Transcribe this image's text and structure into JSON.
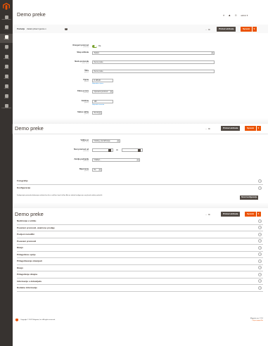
{
  "sidebar": {
    "items": [
      {
        "label": "Nadzorna ploča",
        "icon": "dashboard-icon"
      },
      {
        "label": "Prodaja",
        "icon": "dollar-icon"
      },
      {
        "label": "Katalog",
        "icon": "box-icon"
      },
      {
        "label": "Kupci",
        "icon": "user-icon"
      },
      {
        "label": "Marketing",
        "icon": "megaphone-icon"
      },
      {
        "label": "Sadržaj",
        "icon": "layout-icon"
      },
      {
        "label": "Izvještaji",
        "icon": "bar-chart-icon"
      },
      {
        "label": "Trgovine",
        "icon": "store-icon"
      },
      {
        "label": "Sustav",
        "icon": "gear-icon"
      },
      {
        "label": "Pronađi partnere",
        "icon": "partners-icon"
      }
    ],
    "active_index": 2
  },
  "header": {
    "title": "Demo preke",
    "user": "admin ▾"
  },
  "actions": {
    "back": "← Iši",
    "add_attribute": "Pridod atributa",
    "save": "Spremi"
  },
  "store_switch": {
    "label": "Područje",
    "value": "Zadani prikaz trgovine ▾",
    "help": "?"
  },
  "form1": {
    "rows": [
      {
        "label": "Omogući proizvod",
        "scope": "[website]",
        "value": "Da"
      },
      {
        "label": "Skup atributa",
        "value": "Zadani"
      },
      {
        "label": "Naziv proizvoda",
        "scope": "[store view]",
        "value": "Demo preke"
      },
      {
        "label": "Šifra",
        "scope": "[global]",
        "value": "Demo preke"
      },
      {
        "label": "Cijena",
        "scope": "[global]",
        "value": "€ 135,00",
        "link": "Napredne cijene"
      },
      {
        "label": "Klasa poreza",
        "scope": "[website]",
        "value": "Oporezivi proizvod"
      },
      {
        "label": "Količina",
        "scope": "[global]",
        "value": "100",
        "link": "Napredni inventar"
      },
      {
        "label": "Status zaliha",
        "scope": "[global]",
        "value": "Na zalihi"
      }
    ]
  },
  "form2": {
    "rows": [
      {
        "label": "Vidljivost",
        "scope": "[store view]",
        "value": "Katalog, pretraživanje"
      },
      {
        "label": "Novi proizvod od",
        "scope": "[website]",
        "value": "",
        "to": "do"
      },
      {
        "label": "Zemlja podrijetla",
        "scope": "[website]",
        "value": "Odaberi..."
      },
      {
        "label": "Napomena",
        "scope": "[global]",
        "value": "Ne"
      }
    ]
  },
  "sections1": [
    {
      "title": "Fotografije"
    },
    {
      "title": "Konfiguracije"
    }
  ],
  "config_note": "Konfigurirajte proizvode dodavanjem atributa kao što su veličina, boja ili slično. Ako ne trebate konfiguracije, ovaj korak možete preskočiti.",
  "config_button": "Stvori konfiguracije",
  "sections2": [
    {
      "title": "Nadziranje u vidiku"
    },
    {
      "title": "Poveženi proizvodi, unakrsne prodaje"
    },
    {
      "title": "Povijest narudžbi"
    },
    {
      "title": "Povezani proizvodi"
    },
    {
      "title": "Dizajn"
    },
    {
      "title": "Prilagođene opcije"
    },
    {
      "title": "Prilagođavanje obavijesti"
    },
    {
      "title": "Dizajn"
    },
    {
      "title": "Prilagođenje dizajna"
    },
    {
      "title": "Informacije o dobavljaču"
    },
    {
      "title": "Dodatne informacije"
    }
  ],
  "footer": {
    "copyright": "Copyright © 2017 Magento, Inc. All rights reserved.",
    "version": "Magento ver. 2.2.0",
    "report": "Prijavi pogrešku"
  },
  "colors": {
    "sidebar": "#373330",
    "accent": "#eb5202",
    "dark_button": "#514943",
    "toggle_on": "#79a22e"
  }
}
